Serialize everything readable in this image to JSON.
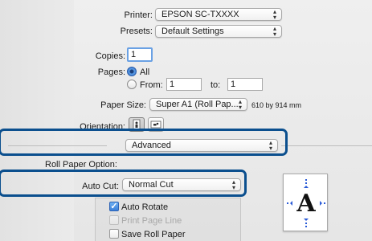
{
  "printer": {
    "label": "Printer:",
    "value": "EPSON SC-TXXXX"
  },
  "presets": {
    "label": "Presets:",
    "value": "Default Settings"
  },
  "copies": {
    "label": "Copies:",
    "value": "1"
  },
  "pages": {
    "label": "Pages:",
    "all_label": "All",
    "from_label": "From:",
    "from_value": "1",
    "to_label": "to:",
    "to_value": "1"
  },
  "paper_size": {
    "label": "Paper Size:",
    "value": "Super A1 (Roll Pap...",
    "dimensions": "610 by 914 mm"
  },
  "orientation": {
    "label": "Orientation:"
  },
  "panel_select": {
    "value": "Advanced"
  },
  "roll_paper_option": {
    "heading": "Roll Paper Option:"
  },
  "auto_cut": {
    "label": "Auto Cut:",
    "value": "Normal Cut"
  },
  "options": {
    "auto_rotate": {
      "label": "Auto Rotate",
      "checked": true,
      "enabled": true
    },
    "print_page_line": {
      "label": "Print Page Line",
      "checked": false,
      "enabled": false
    },
    "save_roll_paper": {
      "label": "Save Roll Paper",
      "checked": false,
      "enabled": true
    }
  },
  "preview": {
    "glyph": "A"
  },
  "colors": {
    "highlight": "#0b4f8e",
    "accent": "#3b7fd8"
  }
}
